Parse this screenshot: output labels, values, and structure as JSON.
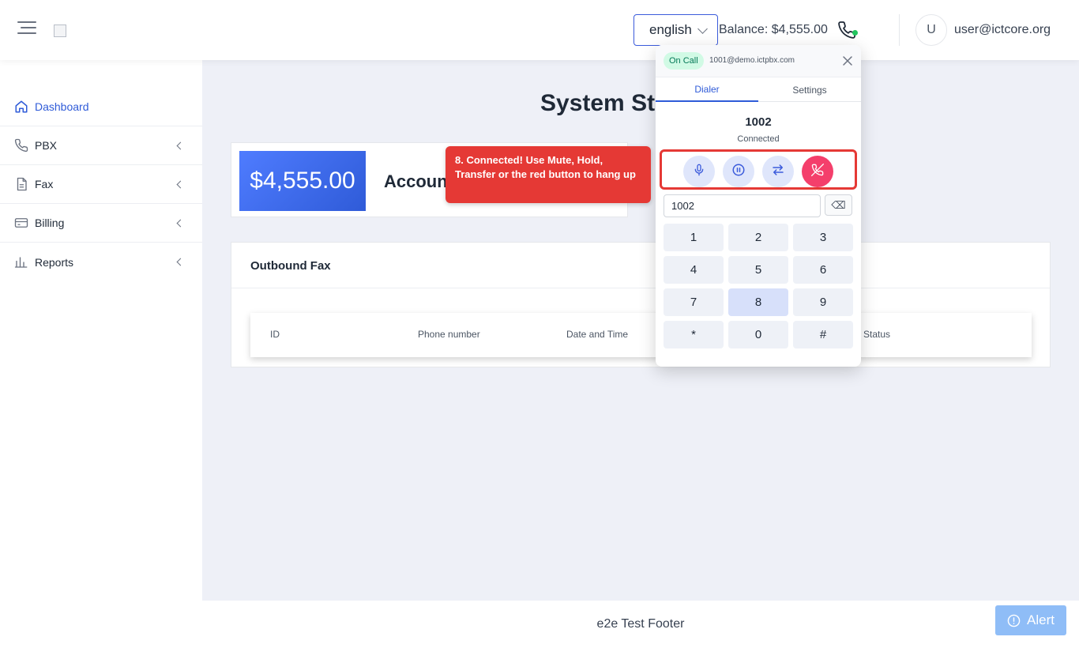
{
  "header": {
    "language": "english",
    "balance_text": "Balance: $4,555.00",
    "avatar_initial": "U",
    "user_email": "user@ictcore.org"
  },
  "sidebar": {
    "items": [
      {
        "label": "Dashboard",
        "icon": "home-icon",
        "active": true
      },
      {
        "label": "PBX",
        "icon": "phone-icon"
      },
      {
        "label": "Fax",
        "icon": "document-icon"
      },
      {
        "label": "Billing",
        "icon": "credit-card-icon"
      },
      {
        "label": "Reports",
        "icon": "bar-chart-icon"
      }
    ]
  },
  "main": {
    "title": "System St",
    "account": {
      "amount": "$4,555.00",
      "label": "Accoun"
    },
    "outbound_fax": {
      "title": "Outbound Fax",
      "columns": [
        "ID",
        "Phone number",
        "Date and Time",
        "Status"
      ]
    }
  },
  "tooltip": {
    "text": "8. Connected! Use Mute, Hold, Transfer or the red button to hang up"
  },
  "dialer": {
    "badge": "On Call",
    "sip_address": "1001@demo.ictpbx.com",
    "tabs": [
      "Dialer",
      "Settings"
    ],
    "active_tab": "Dialer",
    "call_number": "1002",
    "call_status": "Connected",
    "input_value": "1002",
    "backspace_symbol": "⌫",
    "keys": [
      "1",
      "2",
      "3",
      "4",
      "5",
      "6",
      "7",
      "8",
      "9",
      "*",
      "0",
      "#"
    ],
    "pressed_key": "8",
    "controls": [
      "microphone-icon",
      "pause-icon",
      "transfer-icon",
      "hangup-icon"
    ]
  },
  "footer": {
    "text": "e2e Test Footer",
    "alert_label": "Alert"
  },
  "colors": {
    "accent": "#2f5bd8",
    "tooltip_red": "#e53935",
    "hangup_pink": "#f43f6b",
    "alert_blue": "#8fbdf7",
    "on_call_green": "#047857"
  }
}
